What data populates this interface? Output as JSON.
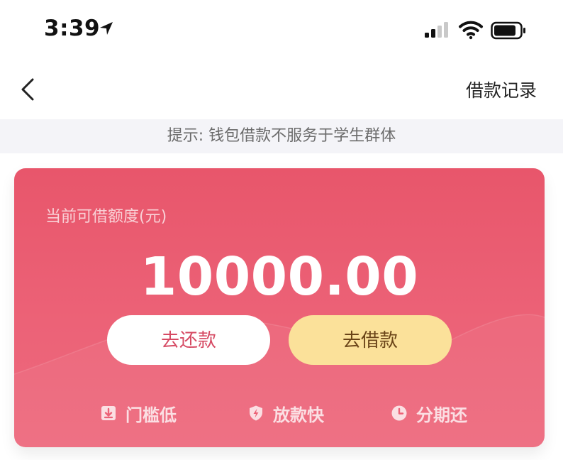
{
  "status_bar": {
    "time": "3:39",
    "icons": [
      "location-arrow-icon",
      "cellular-signal-icon",
      "wifi-icon",
      "battery-icon"
    ]
  },
  "nav": {
    "back_icon": "chevron-left-icon",
    "records_label": "借款记录"
  },
  "notice": {
    "text": "提示: 钱包借款不服务于学生群体"
  },
  "card": {
    "quota_label": "当前可借额度(元)",
    "amount": "10000.00",
    "repay_button": "去还款",
    "borrow_button": "去借款",
    "features": [
      {
        "icon": "download-icon",
        "label": "门槛低"
      },
      {
        "icon": "shield-bolt-icon",
        "label": "放款快"
      },
      {
        "icon": "clock-icon",
        "label": "分期还"
      }
    ]
  },
  "colors": {
    "card_top": "#e8566b",
    "card_bottom": "#ee6a7e",
    "borrow_button_bg": "#fbe19a",
    "repay_text": "#d64a63",
    "notice_bg": "#f4f4f8"
  }
}
